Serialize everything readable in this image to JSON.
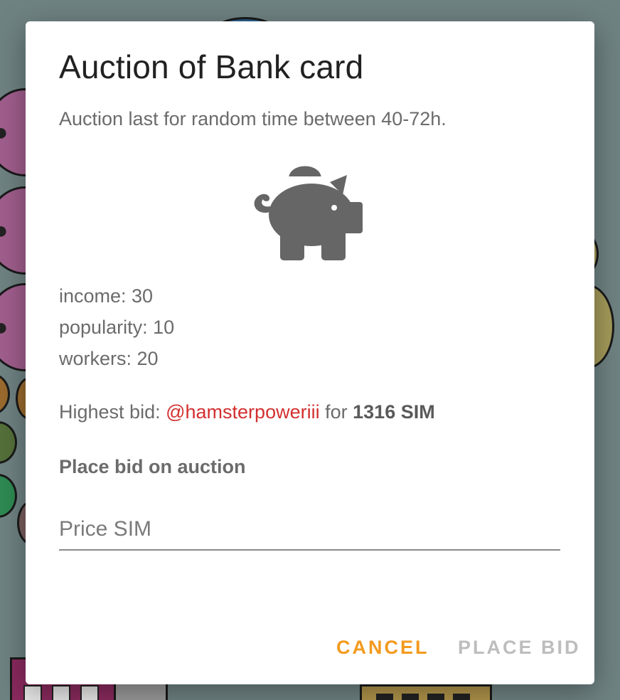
{
  "dialog": {
    "title": "Auction of Bank card",
    "subtitle": "Auction last for random time between 40-72h.",
    "card_icon": "piggy-bank-icon",
    "stats": [
      {
        "label": "income: 30"
      },
      {
        "label": "popularity: 10"
      },
      {
        "label": "workers: 20"
      }
    ],
    "highest_bid": {
      "prefix": "Highest bid:",
      "bidder": "@hamsterpoweriii",
      "connector": "for",
      "amount": "1316 SIM"
    },
    "form_label": "Place bid on auction",
    "price_input": {
      "placeholder": "Price SIM",
      "value": ""
    },
    "cancel_label": "CANCEL",
    "place_bid_label": "PLACE BID"
  },
  "colors": {
    "overlay": "#6f8282",
    "accent_orange": "#f39a1e",
    "bidder_red": "#d32f2f",
    "disabled_text": "#bdbdbd",
    "icon_gray": "#666666"
  }
}
